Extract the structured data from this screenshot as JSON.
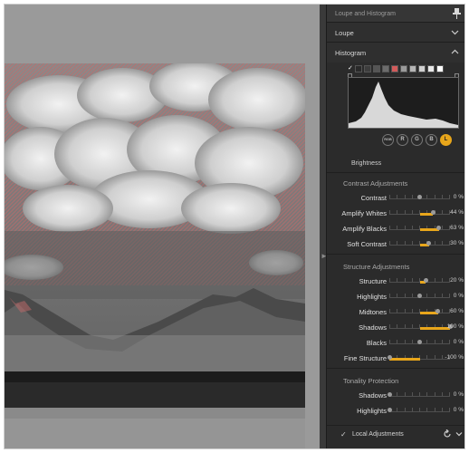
{
  "panel": {
    "header_title": "Loupe and Histogram",
    "loupe_label": "Loupe",
    "histogram_label": "Histogram",
    "brightness_label": "Brightness",
    "channel_buttons": [
      "RGB",
      "R",
      "G",
      "B",
      "L"
    ],
    "active_channel": "L",
    "swatch_colors": [
      "#111111",
      "#2a2a2a",
      "#3d3d3d",
      "#555555",
      "#6c6c6c",
      "#d25b5b",
      "#9a9a9a",
      "#b5b5b5",
      "#d0d0d0",
      "#e8e8e8",
      "#ffffff"
    ]
  },
  "contrast": {
    "title": "Contrast Adjustments",
    "items": [
      {
        "label": "Contrast",
        "value": "0 %",
        "percent": 0
      },
      {
        "label": "Amplify Whites",
        "value": "44 %",
        "percent": 44
      },
      {
        "label": "Amplify Blacks",
        "value": "63 %",
        "percent": 63
      },
      {
        "label": "Soft Contrast",
        "value": "30 %",
        "percent": 30
      }
    ]
  },
  "structure": {
    "title": "Structure Adjustments",
    "items": [
      {
        "label": "Structure",
        "value": "20 %",
        "percent": 20
      },
      {
        "label": "Highlights",
        "value": "0 %",
        "percent": 0
      },
      {
        "label": "Midtones",
        "value": "60 %",
        "percent": 60
      },
      {
        "label": "Shadows",
        "value": "100 %",
        "percent": 100
      },
      {
        "label": "Blacks",
        "value": "0 %",
        "percent": 0
      },
      {
        "label": "Fine Structure",
        "value": "-100 %",
        "percent": -100
      }
    ]
  },
  "tonality": {
    "title": "Tonality Protection",
    "items": [
      {
        "label": "Shadows",
        "value": "0 %",
        "percent": 0,
        "unipolar": true
      },
      {
        "label": "Highlights",
        "value": "0 %",
        "percent": 0,
        "unipolar": true
      }
    ]
  },
  "local": {
    "label": "Local Adjustments"
  },
  "colors": {
    "accent": "#e8a61b",
    "panel_bg": "#2b2b2b",
    "overlay": "#c46a6a"
  }
}
